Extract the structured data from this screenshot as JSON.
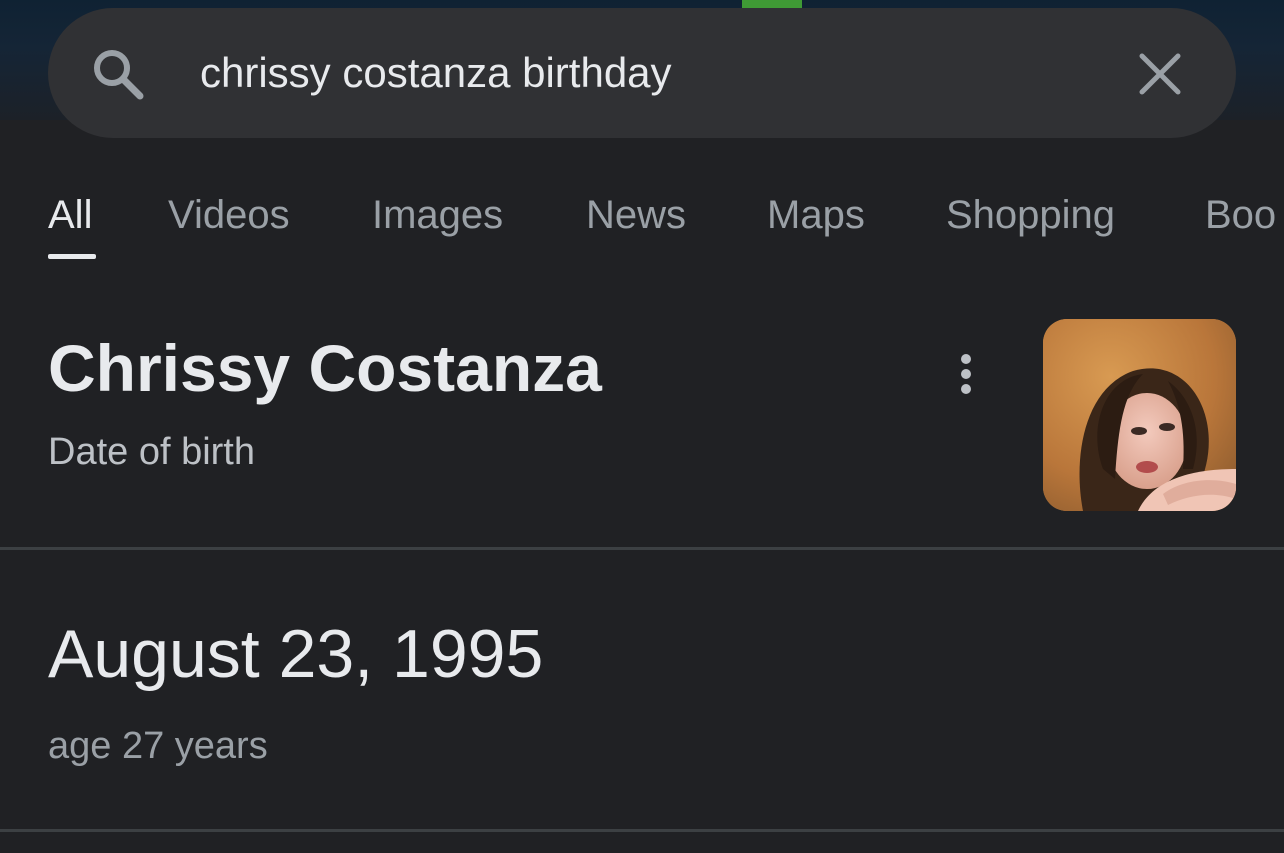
{
  "search": {
    "query": "chrissy costanza birthday",
    "search_icon": "search-icon",
    "clear_icon": "close-icon"
  },
  "tabs": [
    {
      "label": "All",
      "active": true
    },
    {
      "label": "Videos",
      "active": false
    },
    {
      "label": "Images",
      "active": false
    },
    {
      "label": "News",
      "active": false
    },
    {
      "label": "Maps",
      "active": false
    },
    {
      "label": "Shopping",
      "active": false
    },
    {
      "label": "Boo",
      "active": false
    }
  ],
  "entity": {
    "name": "Chrissy Costanza",
    "subtitle": "Date of birth",
    "more_icon": "more-vert-icon",
    "thumbnail_icon": "person-photo"
  },
  "answer": {
    "value": "August 23, 1995",
    "detail": "age 27 years"
  },
  "colors": {
    "background": "#202124",
    "search_bar": "#303134",
    "text_primary": "#e8eaed",
    "text_secondary": "#9aa0a6",
    "divider": "#3c4043"
  }
}
